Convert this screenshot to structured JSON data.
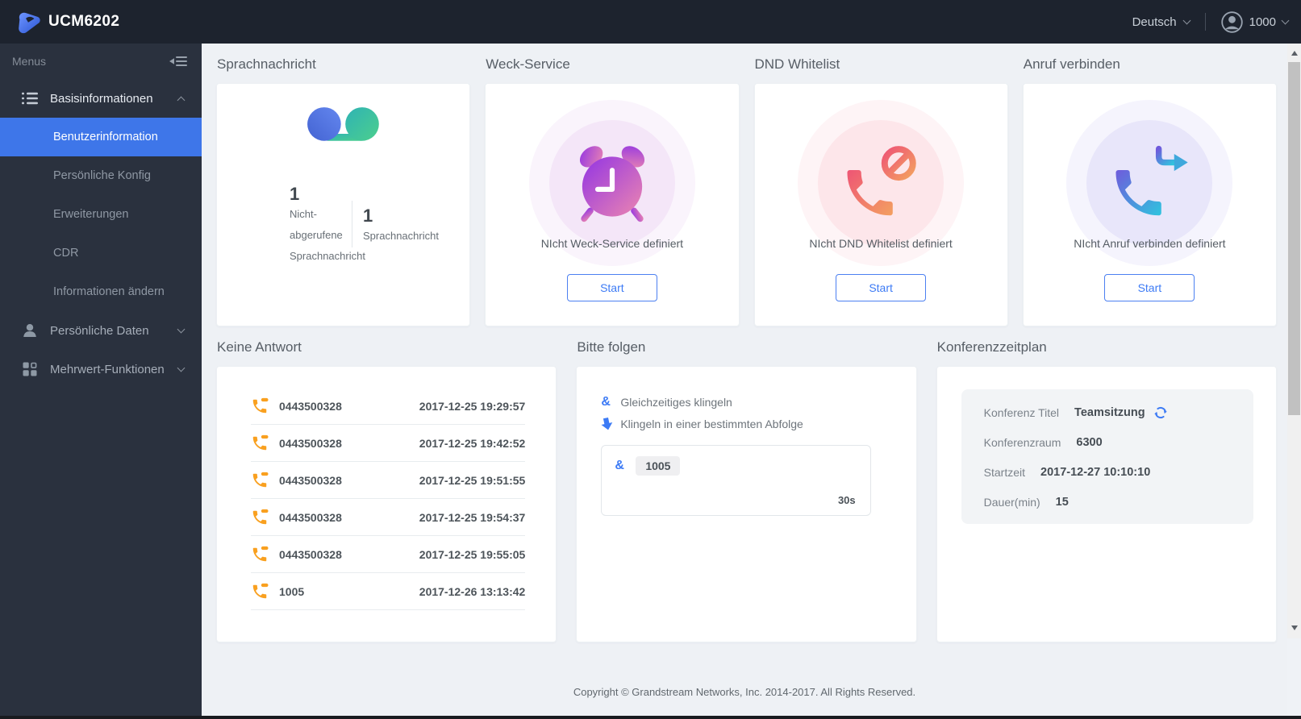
{
  "header": {
    "brand": "UCM6202",
    "language": "Deutsch",
    "user_id": "1000"
  },
  "sidebar": {
    "menus_label": "Menus",
    "groups": [
      {
        "label": "Basisinformationen",
        "icon": "list-icon",
        "children": [
          "Benutzerinformation",
          "Persönliche Konfig",
          "Erweiterungen",
          "CDR",
          "Informationen ändern"
        ]
      },
      {
        "label": "Persönliche Daten",
        "icon": "person-icon"
      },
      {
        "label": "Mehrwert-Funktionen",
        "icon": "grid-icon"
      }
    ],
    "active_item": "Benutzerinformation"
  },
  "cards": {
    "voicemail": {
      "title": "Sprachnachricht",
      "unread_value": "1",
      "unread_label": "Nicht-abgerufene Sprachnachricht",
      "total_value": "1",
      "total_label": "Sprachnachricht"
    },
    "wakeup": {
      "title": "Weck-Service",
      "status": "NIcht Weck-Service definiert",
      "button_label": "Start"
    },
    "dnd_whitelist": {
      "title": "DND Whitelist",
      "status": "NIcht DND Whitelist definiert",
      "button_label": "Start"
    },
    "call_transfer": {
      "title": "Anruf verbinden",
      "status": "NIcht Anruf verbinden definiert",
      "button_label": "Start"
    },
    "no_answer": {
      "title": "Keine Antwort",
      "calls": [
        {
          "number": "0443500328",
          "time": "2017-12-25 19:29:57"
        },
        {
          "number": "0443500328",
          "time": "2017-12-25 19:42:52"
        },
        {
          "number": "0443500328",
          "time": "2017-12-25 19:51:55"
        },
        {
          "number": "0443500328",
          "time": "2017-12-25 19:54:37"
        },
        {
          "number": "0443500328",
          "time": "2017-12-25 19:55:05"
        },
        {
          "number": "1005",
          "time": "2017-12-26 13:13:42"
        }
      ]
    },
    "follow_me": {
      "title": "Bitte folgen",
      "amp_symbol": "&",
      "option_simultaneous": "Gleichzeitiges klingeln",
      "option_sequential": "Klingeln in einer bestimmten Abfolge",
      "member_number": "1005",
      "ring_time": "30s"
    },
    "conference": {
      "title": "Konferenzzeitplan",
      "fields": [
        {
          "label": "Konferenz Titel",
          "value": "Teamsitzung"
        },
        {
          "label": "Konferenzraum",
          "value": "6300"
        },
        {
          "label": "Startzeit",
          "value": "2017-12-27 10:10:10"
        },
        {
          "label": "Dauer(min)",
          "value": "15"
        }
      ]
    }
  },
  "footer": {
    "copyright": "Copyright © Grandstream Networks, Inc. 2014-2017. All Rights Reserved."
  },
  "colors": {
    "accent_blue": "#3d7bf5",
    "active_menu_bg": "#3e76e9",
    "missed_call_orange": "#f9a01f",
    "header_bg": "#1d232e",
    "sidebar_bg": "#2a313e"
  }
}
